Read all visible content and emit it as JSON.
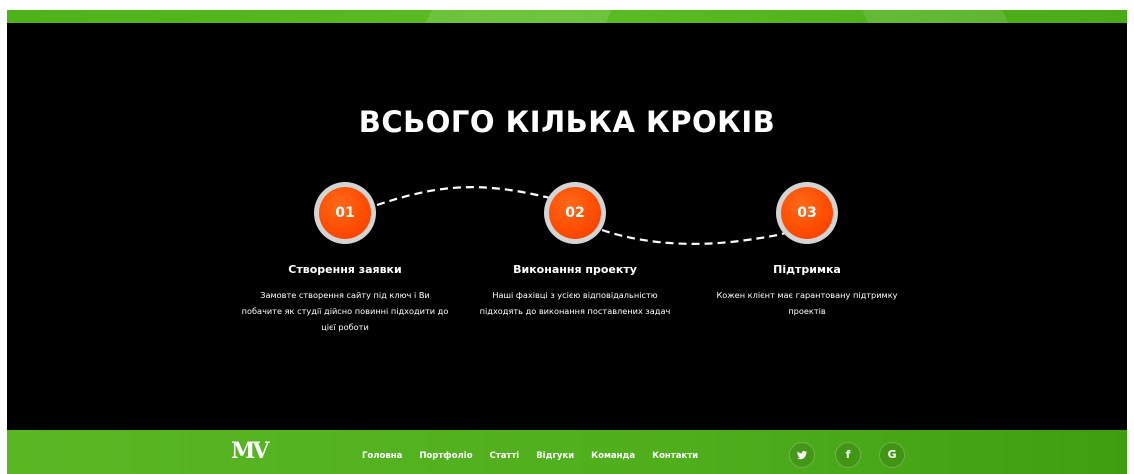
{
  "section": {
    "title": "ВСЬОГО КІЛЬКА КРОКІВ"
  },
  "steps": [
    {
      "number": "01",
      "title": "Створення заявки",
      "description_lines": [
        "Замовте створення сайту під ключ і Ви",
        "побачите як студії дійсно повинні підходити до",
        "цієї роботи"
      ]
    },
    {
      "number": "02",
      "title": "Виконання проекту",
      "description_lines": [
        "Наші фахівці з усією відповідальністю",
        "підходять до виконання поставлених задач"
      ]
    },
    {
      "number": "03",
      "title": "Підтримка",
      "description_lines": [
        "Кожен клієнт має гарантовану підтримку",
        "проектів"
      ]
    }
  ],
  "footer": {
    "logo": "MV",
    "nav": [
      "Головна",
      "Портфоліо",
      "Статті",
      "Відгуки",
      "Команда",
      "Контакти"
    ],
    "social": [
      {
        "icon": "twitter-icon",
        "glyph": "🐦"
      },
      {
        "icon": "facebook-icon",
        "glyph": "f"
      },
      {
        "icon": "google-icon",
        "glyph": "G"
      }
    ]
  },
  "colors": {
    "accent_green": "#4fb21a",
    "step_orange": "#ff4d00",
    "background": "#000000"
  }
}
